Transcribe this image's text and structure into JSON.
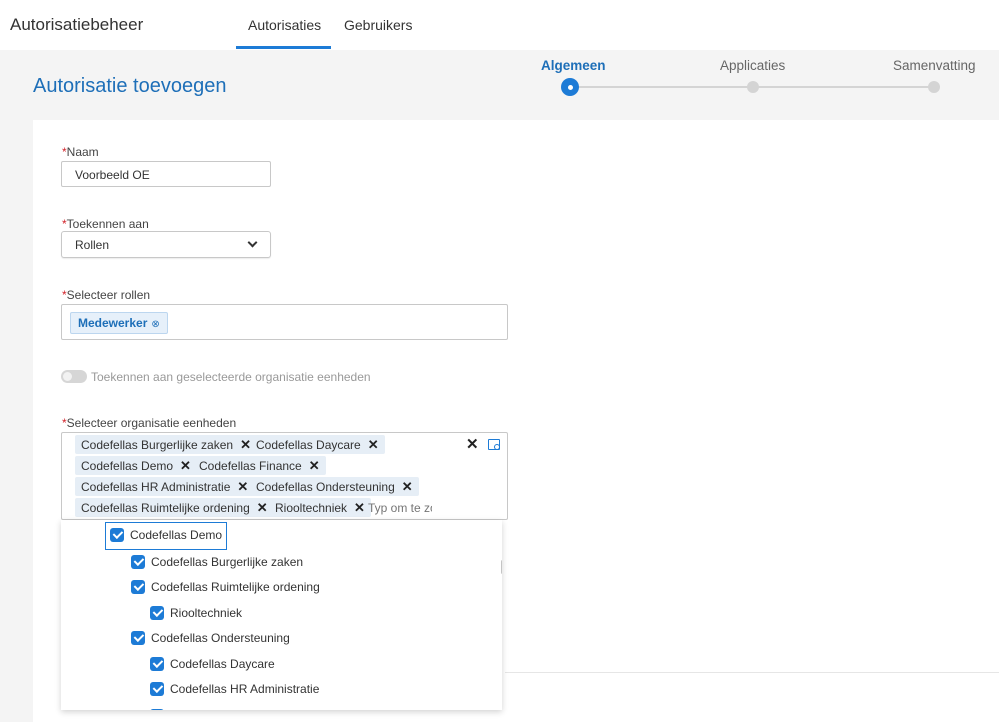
{
  "app": {
    "title": "Autorisatiebeheer"
  },
  "nav": {
    "tabs": [
      "Autorisaties",
      "Gebruikers"
    ]
  },
  "page": {
    "title": "Autorisatie toevoegen"
  },
  "stepper": {
    "steps": [
      "Algemeen",
      "Applicaties",
      "Samenvatting"
    ],
    "active": "Algemeen"
  },
  "form": {
    "required_mark": "*",
    "naam": {
      "label": "Naam",
      "value": "Voorbeeld OE"
    },
    "toekennen": {
      "label": "Toekennen aan",
      "value": "Rollen"
    },
    "rollen": {
      "label": "Selecteer rollen",
      "chip": "Medewerker",
      "chip_remove": "⊗"
    },
    "toggle": {
      "label": "Toekennen aan geselecteerde organisatie eenheden"
    },
    "org": {
      "label": "Selecteer organisatie eenheden",
      "chips": [
        "Codefellas Burgerlijke zaken",
        "Codefellas Daycare",
        "Codefellas Demo",
        "Codefellas Finance",
        "Codefellas HR Administratie",
        "Codefellas Ondersteuning",
        "Codefellas Ruimtelijke ordening",
        "Riooltechniek"
      ],
      "chip_remove": "✕",
      "clear_all": "✕",
      "placeholder": "Typ om te zoeken"
    }
  },
  "tree": [
    "Codefellas Demo",
    "Codefellas Burgerlijke zaken",
    "Codefellas Ruimtelijke ordening",
    "Riooltechniek",
    "Codefellas Ondersteuning",
    "Codefellas Daycare",
    "Codefellas HR Administratie"
  ],
  "colors": {
    "accent": "#1d7bd6",
    "title": "#1e6fb8",
    "required": "#d2232a"
  }
}
